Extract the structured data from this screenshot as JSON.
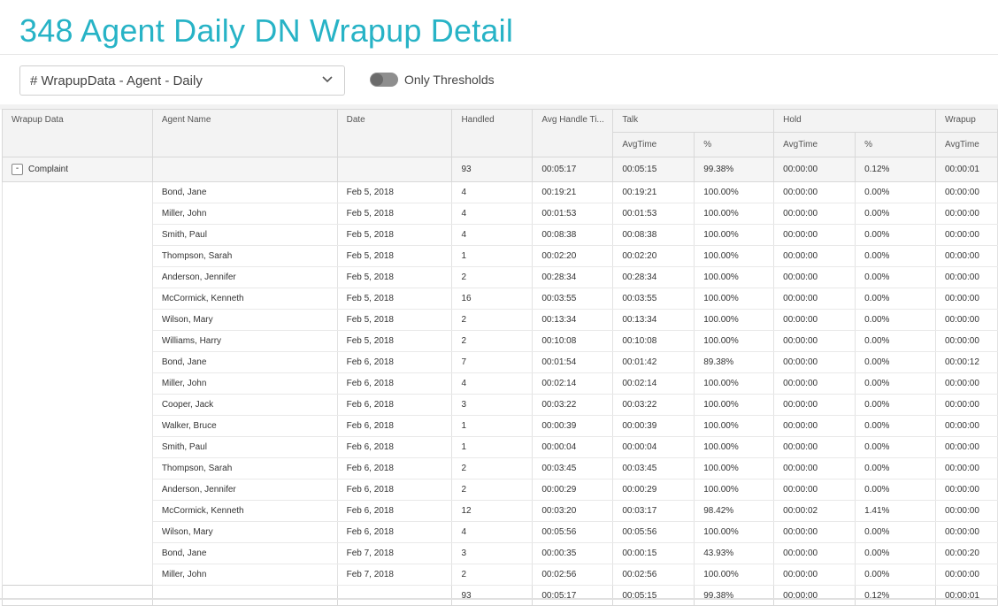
{
  "page_title": "348 Agent Daily DN Wrapup Detail",
  "dataset_select": {
    "value": "# WrapupData - Agent - Daily"
  },
  "toggle": {
    "label": "Only Thresholds",
    "on": false
  },
  "columns": {
    "wrapup_data": "Wrapup Data",
    "agent_name": "Agent Name",
    "date": "Date",
    "handled": "Handled",
    "avg_handle_time": "Avg Handle Ti...",
    "talk": "Talk",
    "hold": "Hold",
    "wrapup": "Wrapup",
    "avgtime": "AvgTime",
    "pct": "%"
  },
  "group": {
    "expander": "-",
    "label": "Complaint",
    "handled": "93",
    "avg_handle": "00:05:17",
    "talk_avg": "00:05:15",
    "talk_pct": "99.38%",
    "hold_avg": "00:00:00",
    "hold_pct": "0.12%",
    "wrapup_avg": "00:00:01"
  },
  "rows": [
    {
      "agent": "Bond, Jane",
      "date": "Feb 5, 2018",
      "handled": "4",
      "aht": "00:19:21",
      "talk": "00:19:21",
      "talk_pct": "100.00%",
      "hold": "00:00:00",
      "hold_pct": "0.00%",
      "wrapup": "00:00:00"
    },
    {
      "agent": "Miller, John",
      "date": "Feb 5, 2018",
      "handled": "4",
      "aht": "00:01:53",
      "talk": "00:01:53",
      "talk_pct": "100.00%",
      "hold": "00:00:00",
      "hold_pct": "0.00%",
      "wrapup": "00:00:00"
    },
    {
      "agent": "Smith, Paul",
      "date": "Feb 5, 2018",
      "handled": "4",
      "aht": "00:08:38",
      "talk": "00:08:38",
      "talk_pct": "100.00%",
      "hold": "00:00:00",
      "hold_pct": "0.00%",
      "wrapup": "00:00:00"
    },
    {
      "agent": "Thompson, Sarah",
      "date": "Feb 5, 2018",
      "handled": "1",
      "aht": "00:02:20",
      "talk": "00:02:20",
      "talk_pct": "100.00%",
      "hold": "00:00:00",
      "hold_pct": "0.00%",
      "wrapup": "00:00:00"
    },
    {
      "agent": "Anderson, Jennifer",
      "date": "Feb 5, 2018",
      "handled": "2",
      "aht": "00:28:34",
      "talk": "00:28:34",
      "talk_pct": "100.00%",
      "hold": "00:00:00",
      "hold_pct": "0.00%",
      "wrapup": "00:00:00"
    },
    {
      "agent": "McCormick, Kenneth",
      "date": "Feb 5, 2018",
      "handled": "16",
      "aht": "00:03:55",
      "talk": "00:03:55",
      "talk_pct": "100.00%",
      "hold": "00:00:00",
      "hold_pct": "0.00%",
      "wrapup": "00:00:00"
    },
    {
      "agent": "Wilson, Mary",
      "date": "Feb 5, 2018",
      "handled": "2",
      "aht": "00:13:34",
      "talk": "00:13:34",
      "talk_pct": "100.00%",
      "hold": "00:00:00",
      "hold_pct": "0.00%",
      "wrapup": "00:00:00"
    },
    {
      "agent": "Williams, Harry",
      "date": "Feb 5, 2018",
      "handled": "2",
      "aht": "00:10:08",
      "talk": "00:10:08",
      "talk_pct": "100.00%",
      "hold": "00:00:00",
      "hold_pct": "0.00%",
      "wrapup": "00:00:00"
    },
    {
      "agent": "Bond, Jane",
      "date": "Feb 6, 2018",
      "handled": "7",
      "aht": "00:01:54",
      "talk": "00:01:42",
      "talk_pct": "89.38%",
      "hold": "00:00:00",
      "hold_pct": "0.00%",
      "wrapup": "00:00:12"
    },
    {
      "agent": "Miller, John",
      "date": "Feb 6, 2018",
      "handled": "4",
      "aht": "00:02:14",
      "talk": "00:02:14",
      "talk_pct": "100.00%",
      "hold": "00:00:00",
      "hold_pct": "0.00%",
      "wrapup": "00:00:00"
    },
    {
      "agent": "Cooper, Jack",
      "date": "Feb 6, 2018",
      "handled": "3",
      "aht": "00:03:22",
      "talk": "00:03:22",
      "talk_pct": "100.00%",
      "hold": "00:00:00",
      "hold_pct": "0.00%",
      "wrapup": "00:00:00"
    },
    {
      "agent": "Walker, Bruce",
      "date": "Feb 6, 2018",
      "handled": "1",
      "aht": "00:00:39",
      "talk": "00:00:39",
      "talk_pct": "100.00%",
      "hold": "00:00:00",
      "hold_pct": "0.00%",
      "wrapup": "00:00:00"
    },
    {
      "agent": "Smith, Paul",
      "date": "Feb 6, 2018",
      "handled": "1",
      "aht": "00:00:04",
      "talk": "00:00:04",
      "talk_pct": "100.00%",
      "hold": "00:00:00",
      "hold_pct": "0.00%",
      "wrapup": "00:00:00"
    },
    {
      "agent": "Thompson, Sarah",
      "date": "Feb 6, 2018",
      "handled": "2",
      "aht": "00:03:45",
      "talk": "00:03:45",
      "talk_pct": "100.00%",
      "hold": "00:00:00",
      "hold_pct": "0.00%",
      "wrapup": "00:00:00"
    },
    {
      "agent": "Anderson, Jennifer",
      "date": "Feb 6, 2018",
      "handled": "2",
      "aht": "00:00:29",
      "talk": "00:00:29",
      "talk_pct": "100.00%",
      "hold": "00:00:00",
      "hold_pct": "0.00%",
      "wrapup": "00:00:00"
    },
    {
      "agent": "McCormick, Kenneth",
      "date": "Feb 6, 2018",
      "handled": "12",
      "aht": "00:03:20",
      "talk": "00:03:17",
      "talk_pct": "98.42%",
      "hold": "00:00:02",
      "hold_pct": "1.41%",
      "wrapup": "00:00:00"
    },
    {
      "agent": "Wilson, Mary",
      "date": "Feb 6, 2018",
      "handled": "4",
      "aht": "00:05:56",
      "talk": "00:05:56",
      "talk_pct": "100.00%",
      "hold": "00:00:00",
      "hold_pct": "0.00%",
      "wrapup": "00:00:00"
    },
    {
      "agent": "Bond, Jane",
      "date": "Feb 7, 2018",
      "handled": "3",
      "aht": "00:00:35",
      "talk": "00:00:15",
      "talk_pct": "43.93%",
      "hold": "00:00:00",
      "hold_pct": "0.00%",
      "wrapup": "00:00:20"
    },
    {
      "agent": "Miller, John",
      "date": "Feb 7, 2018",
      "handled": "2",
      "aht": "00:02:56",
      "talk": "00:02:56",
      "talk_pct": "100.00%",
      "hold": "00:00:00",
      "hold_pct": "0.00%",
      "wrapup": "00:00:00"
    }
  ],
  "totals": {
    "handled": "93",
    "avg_handle": "00:05:17",
    "talk_avg": "00:05:15",
    "talk_pct": "99.38%",
    "hold_avg": "00:00:00",
    "hold_pct": "0.12%",
    "wrapup_avg": "00:00:01"
  }
}
